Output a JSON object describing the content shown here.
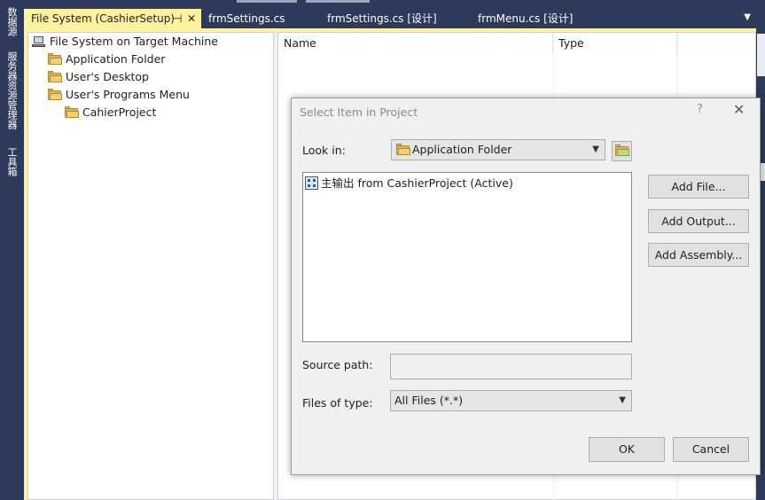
{
  "side_panel": {
    "tabs": [
      "数据源",
      "服务器资源管理器",
      "工具箱"
    ]
  },
  "tabs": [
    {
      "label": "File System (CashierSetup)",
      "active": true
    },
    {
      "label": "frmSettings.cs",
      "active": false
    },
    {
      "label": "frmSettings.cs [设计]",
      "active": false
    },
    {
      "label": "frmMenu.cs [设计]",
      "active": false
    }
  ],
  "tree": {
    "root": "File System on Target Machine",
    "items": [
      "Application Folder",
      "User's Desktop",
      "User's Programs Menu"
    ],
    "subitem": "CahierProject"
  },
  "list_columns": [
    "Name",
    "Type"
  ],
  "dialog": {
    "title": "Select Item in Project",
    "help": "?",
    "close": "✕",
    "look_in_label": "Look in:",
    "look_in_value": "Application Folder",
    "file_item": "主输出 from CashierProject (Active)",
    "source_path_label": "Source path:",
    "files_of_type_label": "Files of type:",
    "files_of_type_value": "All Files (*.*)",
    "buttons": {
      "add_file": "Add File...",
      "add_output": "Add Output...",
      "add_assembly": "Add Assembly...",
      "ok": "OK",
      "cancel": "Cancel"
    }
  },
  "colors": {
    "ide_background": "#2d3a5c",
    "active_tab": "#fff29d",
    "dialog_background": "#f0f0f0"
  },
  "icons": [
    "computer-icon",
    "folder-icon",
    "pin-icon",
    "close-icon",
    "chevron-down-icon",
    "up-folder-icon",
    "project-output-icon"
  ]
}
